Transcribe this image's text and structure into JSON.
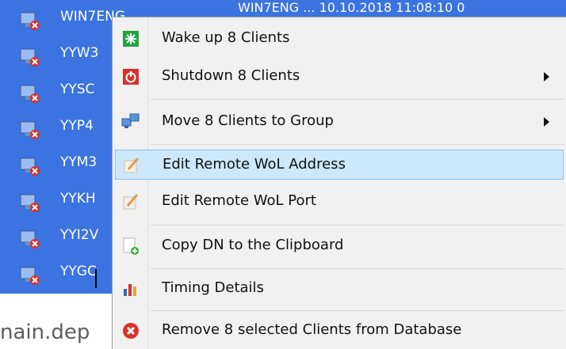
{
  "background": {
    "top_row_text": "WIN7ENG   ...   10.10.2018 11:08:10   0",
    "clients": [
      "WIN7ENG",
      "YYW3",
      "YYSC",
      "YYP4",
      "YYM3",
      "YYKH",
      "YYI2V",
      "YYGC"
    ],
    "domain_fragment": "nain.dep"
  },
  "menu": {
    "items": [
      {
        "label": "Wake up 8 Clients",
        "icon": "wake-icon",
        "submenu": false
      },
      {
        "label": "Shutdown 8 Clients",
        "icon": "power-icon",
        "submenu": true
      },
      {
        "label": "Move 8 Clients to Group",
        "icon": "network-move-icon",
        "submenu": true
      },
      {
        "label": "Edit Remote WoL Address",
        "icon": "edit-icon",
        "submenu": false,
        "highlighted": true
      },
      {
        "label": "Edit Remote WoL Port",
        "icon": "edit-icon",
        "submenu": false
      },
      {
        "label": "Copy DN to the Clipboard",
        "icon": "copy-add-icon",
        "submenu": false
      },
      {
        "label": "Timing Details",
        "icon": "chart-icon",
        "submenu": false
      },
      {
        "label": "Remove 8 selected Clients from Database",
        "icon": "remove-icon",
        "submenu": false
      }
    ]
  },
  "colors": {
    "selection_blue": "#3b73e0",
    "menu_bg": "#f1f1f1",
    "hover_bg": "#cde8fb",
    "hover_border": "#8bc2f0",
    "danger_red": "#d8322b",
    "wake_green": "#1fa640"
  }
}
